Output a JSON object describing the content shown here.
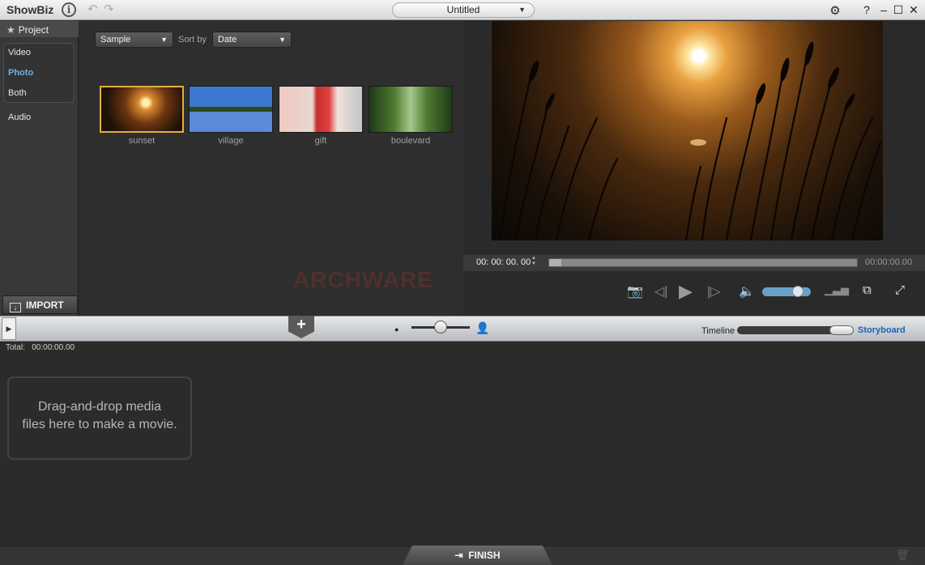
{
  "app": {
    "name": "ShowBiz",
    "document_title": "Untitled"
  },
  "nav": {
    "project_label": "Project",
    "items": [
      {
        "label": "Video",
        "selected": false
      },
      {
        "label": "Photo",
        "selected": true
      },
      {
        "label": "Both",
        "selected": false
      },
      {
        "label": "Audio",
        "selected": false
      }
    ],
    "import_label": "IMPORT"
  },
  "library": {
    "source_value": "Sample",
    "sortby_label": "Sort by",
    "sortby_value": "Date",
    "thumbnails": [
      {
        "label": "sunset",
        "selected": true
      },
      {
        "label": "village",
        "selected": false
      },
      {
        "label": "gift",
        "selected": false
      },
      {
        "label": "boulevard",
        "selected": false
      }
    ],
    "watermark": "ARCHWARE"
  },
  "player": {
    "current_time": "00: 00: 00. 00",
    "total_time": "00:00:00.00",
    "progress_fraction": 0.04,
    "volume_fraction": 0.8
  },
  "toolbar": {
    "timeline_label": "Timeline",
    "storyboard_label": "Storyboard",
    "active_view": "Storyboard"
  },
  "storyboard": {
    "total_label": "Total:",
    "total_value": "00:00:00.00",
    "drop_line1": "Drag-and-drop media",
    "drop_line2": "files here to make a movie."
  },
  "footer": {
    "finish_label": "FINISH"
  },
  "colors": {
    "accent_blue": "#1d64b4",
    "nav_selected": "#6fb2ee",
    "thumb_selected": "#e0b040"
  }
}
